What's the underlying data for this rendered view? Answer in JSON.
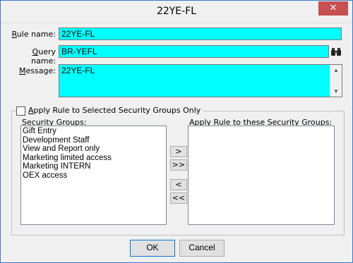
{
  "window": {
    "title": "22YE-FL",
    "close_glyph": "✕"
  },
  "form": {
    "rule_name_label_hot": "R",
    "rule_name_label_rest": "ule name:",
    "rule_name_value": "22YE-FL",
    "query_name_label_hot": "Q",
    "query_name_label_rest": "uery name:",
    "query_name_value": "BR-YEFL",
    "message_label_hot": "M",
    "message_label_rest": "essage:",
    "message_value": "22YE-FL"
  },
  "security": {
    "apply_checkbox_hot": "A",
    "apply_checkbox_rest": "pply Rule to Selected Security Groups Only",
    "apply_checked": false,
    "groups_label": "Security Groups:",
    "groups": [
      "Gift Entry",
      "Development Staff",
      "View and Report only",
      "Marketing limited access",
      "Marketing INTERN",
      "OEX access"
    ],
    "apply_to_label": "Apply Rule to these Security Groups:",
    "apply_to": [],
    "move_right": ">",
    "move_all_right": ">>",
    "move_left": "<",
    "move_all_left": "<<"
  },
  "buttons": {
    "ok": "OK",
    "cancel": "Cancel"
  },
  "colors": {
    "field_bg": "#00ffff",
    "close_bg": "#c75050"
  }
}
